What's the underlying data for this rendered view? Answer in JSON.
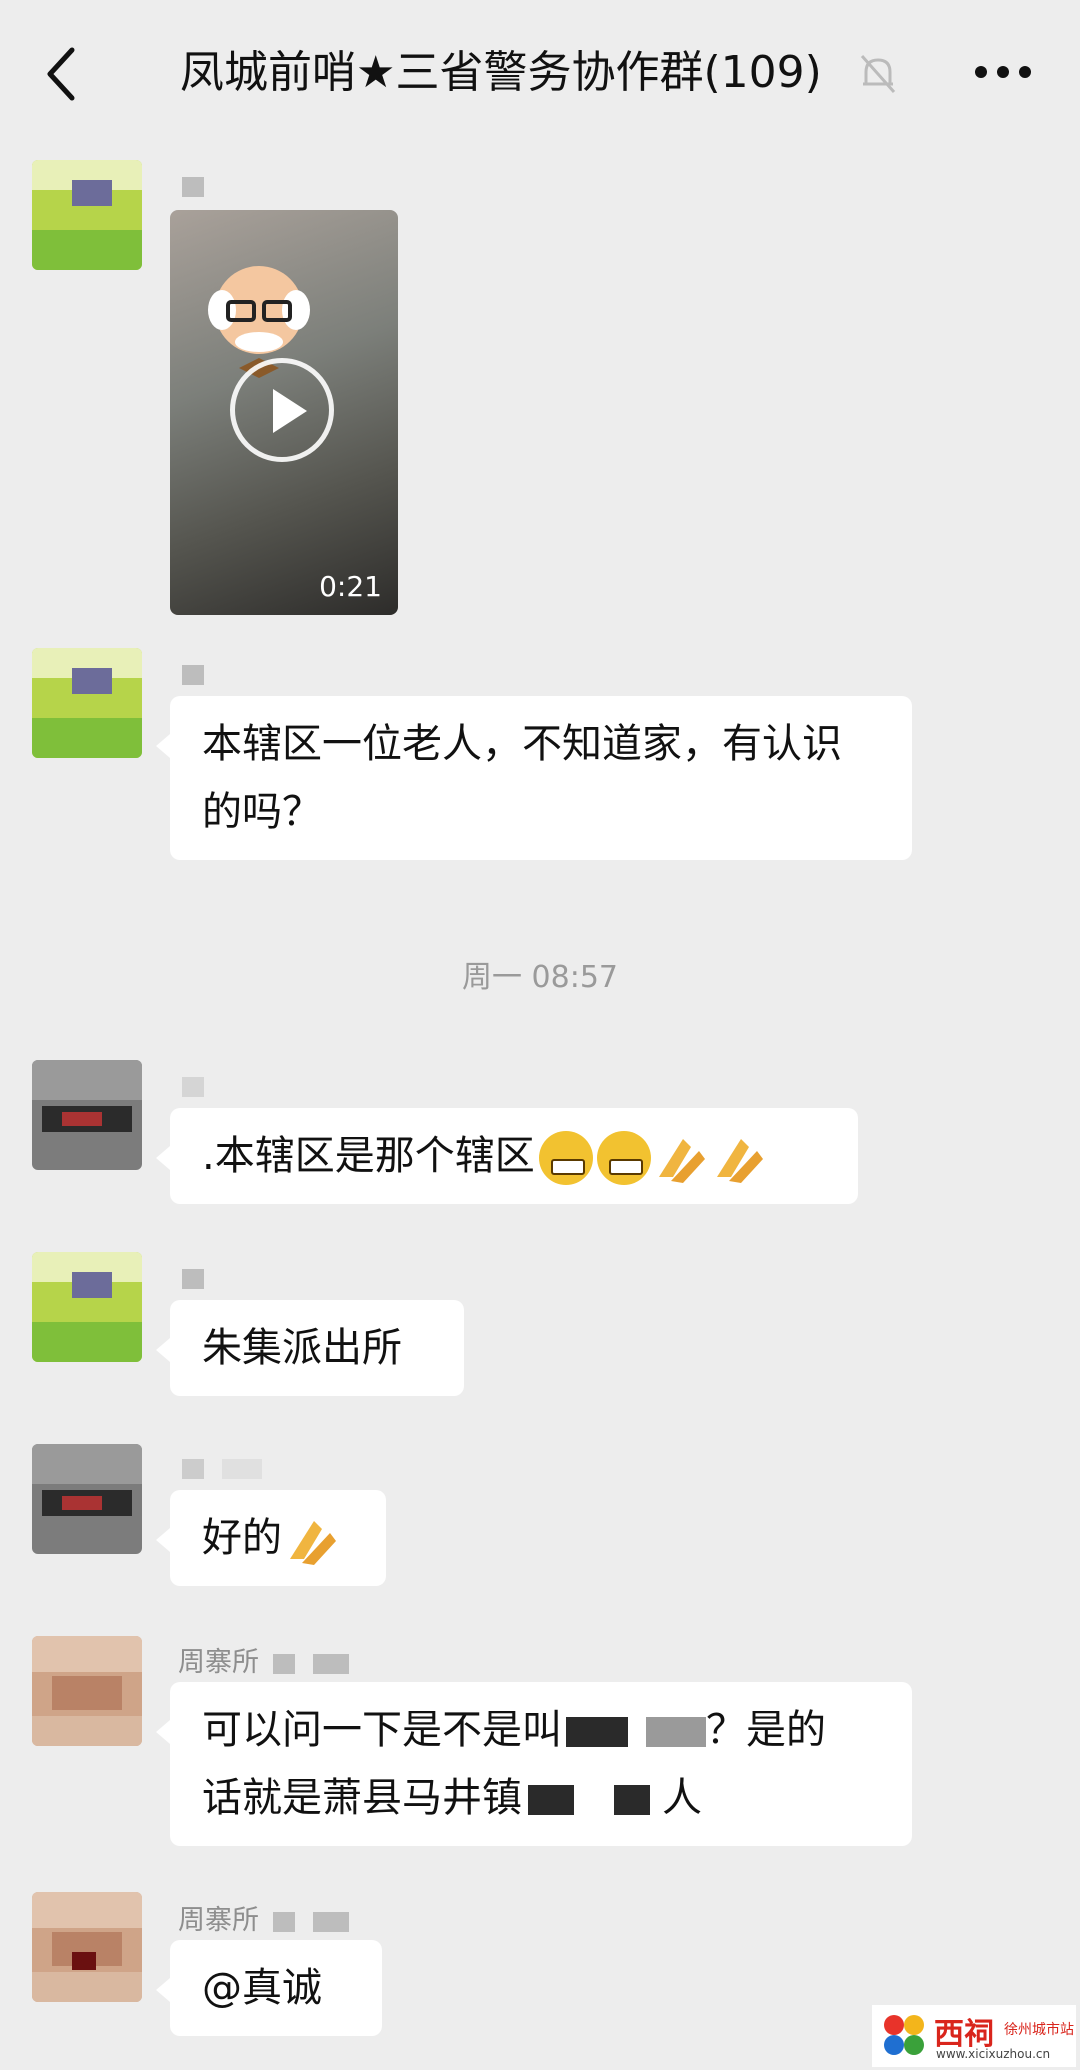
{
  "header": {
    "back_icon": "chevron-left-icon",
    "title": "凤城前哨★三省警务协作群(109)",
    "mute_icon": "bell-off-icon",
    "more_icon": "more-dots-icon"
  },
  "messages": [
    {
      "type": "video",
      "duration": "0:21"
    },
    {
      "type": "text",
      "text": "本辖区一位老人，不知道家，有认识的吗？"
    },
    {
      "type": "text",
      "text": ".本辖区是那个辖区"
    },
    {
      "type": "text",
      "text": "朱集派出所"
    },
    {
      "type": "text",
      "text": "好的"
    },
    {
      "type": "text",
      "sender": "周寨所",
      "line1_a": "可以问一下是不是叫",
      "line1_b": "？是的",
      "line2_a": "话就是萧县马井镇",
      "line2_b": "人"
    },
    {
      "type": "text",
      "sender": "周寨所",
      "text": "@真诚"
    }
  ],
  "timestamp": "周一 08:57",
  "watermark": {
    "name": "西祠",
    "sub": "徐州城市站",
    "url": "www.xicixuzhou.cn"
  },
  "colors": {
    "background": "#ededed",
    "bubble": "#ffffff",
    "watermark_red": "#d9251c"
  }
}
